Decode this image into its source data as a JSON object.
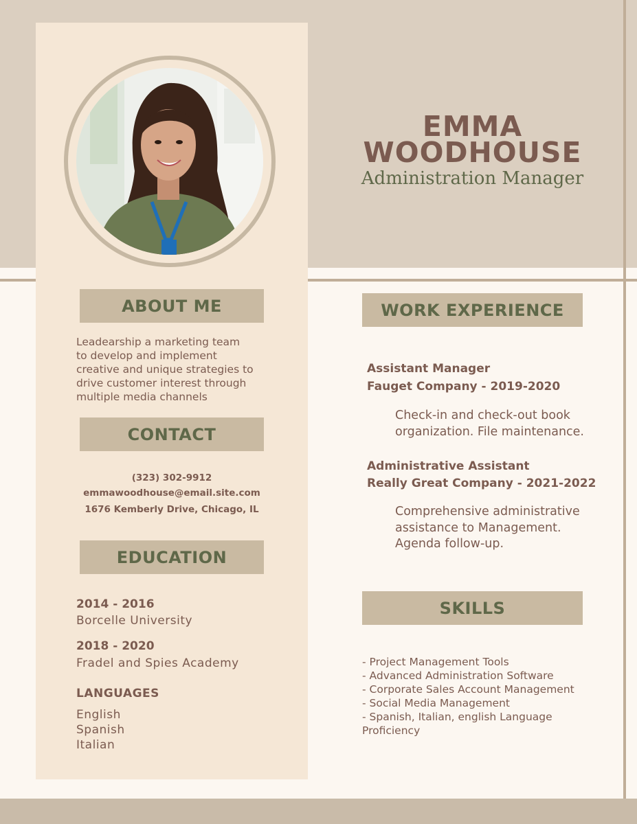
{
  "header": {
    "first_name": "EMMA",
    "last_name": "WOODHOUSE",
    "title": "Administration Manager"
  },
  "about": {
    "heading": "ABOUT ME",
    "lines": [
      "Leadearship a marketing team",
      "to develop and implement",
      "creative and unique strategies to",
      "drive customer interest through",
      "multiple media channels"
    ]
  },
  "contact": {
    "heading": "CONTACT",
    "phone": "(323) 302-9912",
    "email": "emmawoodhouse@email.site.com",
    "address": "1676 Kemberly Drive, Chicago, IL"
  },
  "education": {
    "heading": "EDUCATION",
    "items": [
      {
        "years": "2014 - 2016",
        "school": "Borcelle University"
      },
      {
        "years": "2018 - 2020",
        "school": "Fradel and Spies Academy"
      }
    ]
  },
  "languages": {
    "heading": "LANGUAGES",
    "items": [
      "English",
      "Spanish",
      "Italian"
    ]
  },
  "work": {
    "heading": "WORK EXPERIENCE",
    "jobs": [
      {
        "role": "Assistant Manager",
        "company": "Fauget Company - 2019-2020",
        "desc": [
          "Check-in and check-out book",
          "organization. File maintenance."
        ]
      },
      {
        "role": "Administrative Assistant",
        "company": "Really Great Company - 2021-2022",
        "desc": [
          "Comprehensive administrative",
          "assistance to Management.",
          "Agenda follow-up."
        ]
      }
    ]
  },
  "skills": {
    "heading": "SKILLS",
    "items": [
      "- Project Management Tools",
      "- Advanced Administration Software",
      "- Corporate Sales Account Management",
      "- Social Media Management",
      "- Spanish, Italian, english Language",
      "Proficiency"
    ]
  },
  "colors": {
    "top_band": "#dbcfc0",
    "side_panel": "#f5e7d6",
    "heading_box": "#c9baa2",
    "heading_text": "#5f6849",
    "body_text": "#7b5b50",
    "accent_line": "#c0ae98"
  }
}
